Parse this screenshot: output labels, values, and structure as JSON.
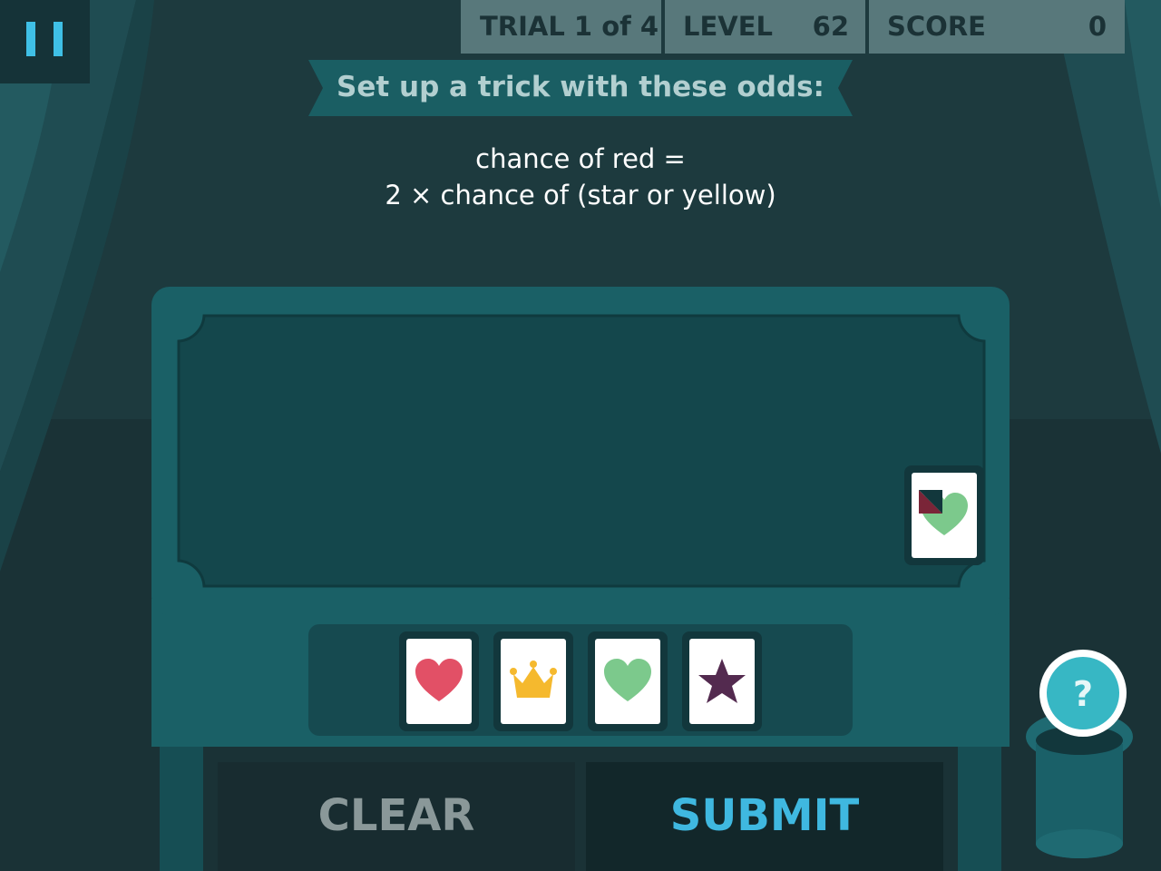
{
  "hud": {
    "trial_label": "TRIAL 1 of 4",
    "level_label": "LEVEL",
    "level_value": "62",
    "score_label": "SCORE",
    "score_value": "0"
  },
  "instruction": {
    "banner": "Set up a trick with these odds:",
    "rule_line1": "chance of red =",
    "rule_line2": "2 × chance of (star or yellow)"
  },
  "table": {
    "placed_cards": [
      {
        "symbol": "heart-icon",
        "color": "#7cc98c"
      }
    ]
  },
  "card_palette": [
    {
      "symbol": "heart-icon",
      "color": "#e25066"
    },
    {
      "symbol": "crown-icon",
      "color": "#f5b92e"
    },
    {
      "symbol": "heart-icon",
      "color": "#7cc98c"
    },
    {
      "symbol": "star-icon",
      "color": "#532a4f"
    }
  ],
  "buttons": {
    "clear": "CLEAR",
    "submit": "SUBMIT"
  },
  "help": {
    "label": "?"
  },
  "colors": {
    "accent": "#3fb8e0",
    "table": "#1a6066",
    "background": "#1d3a3e"
  }
}
